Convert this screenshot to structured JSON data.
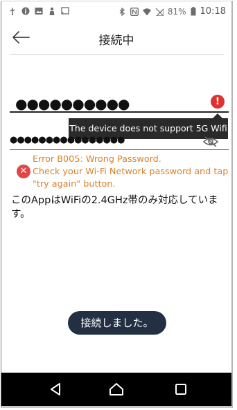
{
  "status_bar": {
    "left_icons": [
      "usb-icon",
      "info-icon",
      "image-icon",
      "person-icon",
      "cast-icon"
    ],
    "right_icons": [
      "bluetooth-icon",
      "nfc-icon",
      "wifi-icon",
      "no-sim-icon",
      "battery-icon"
    ],
    "battery_percent": "81%",
    "time": "10:18"
  },
  "header": {
    "title": "接続中"
  },
  "ssid_field": {
    "value": "●●●●●●●●●●",
    "tooltip": "The device does not support 5G Wifi"
  },
  "password_field": {
    "value": "●●●●●●●●●●●●●●●●"
  },
  "error": {
    "lines": [
      "Error B005: Wrong Password.",
      "Check your Wi-Fi Network password and tap",
      "\"try again\" button."
    ]
  },
  "note": "このAppはWiFiの2.4GHz帯のみ対応していま す。",
  "toast": "接続しました。",
  "colors": {
    "error_red": "#e03030",
    "error_orange": "#d9822b",
    "toast_bg": "#233043",
    "navbar_bg": "#000000"
  }
}
